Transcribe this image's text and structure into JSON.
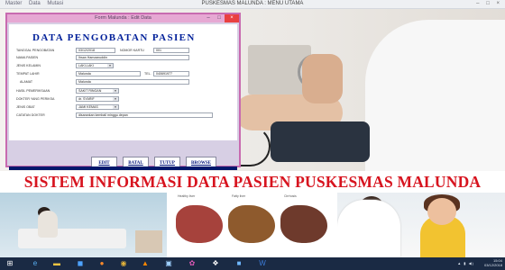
{
  "main_window": {
    "title": "PUSKESMAS MALUNDA : MENU UTAMA",
    "menu_items": [
      "Master",
      "Data",
      "Mutasi"
    ],
    "controls": [
      "–",
      "□",
      "×"
    ]
  },
  "dialog": {
    "title": "Form Malunda : Edit Data",
    "controls": [
      "–",
      "□",
      "×"
    ],
    "heading": "DATA PENGOBATAN PASIEN",
    "fields": {
      "tanggal_label": "TANGGAL PENGOBATAN",
      "tanggal_value": "03/12/2018",
      "nomor_kartu_label": "NOMOR KARTU",
      "nomor_kartu_value": "001",
      "nama_label": "NAMA PASIEN",
      "nama_value": "Ihsan Hamzanuddin",
      "jenis_kelamin_label": "JENIS KELAMIN",
      "jenis_kelamin_value": "LAKI-LAKI",
      "tempat_lahir_label": "TEMPAT LAHIR",
      "tempat_lahir_value": "Malunda",
      "tel_label": "TEL.",
      "tel_value": "040691977",
      "alamat_label": "ALAMAT",
      "alamat_value": "Malunda",
      "hasil_label": "HASIL PEMERIKSAAN",
      "hasil_value": "SAKIT RINGAN",
      "dokter_label": "DOKTER YANG PERIKSA",
      "dokter_value": "dr. SYARIF",
      "obat_label": "JENIS OBAT",
      "obat_value": "JAMI KEMAS",
      "catatan_label": "CATATAN DOKTER",
      "catatan_value": "disarankan kembali minggu depan"
    },
    "buttons": {
      "edit": "EDIT",
      "batal": "BATAL",
      "tutup": "TUTUP",
      "browse": "BROWSE"
    }
  },
  "banner": {
    "text": "SISTEM INFORMASI DATA PASIEN PUSKESMAS MALUNDA"
  },
  "liver_captions": [
    "Healthy liver",
    "Fatty liver",
    "Cirrhosis"
  ],
  "taskbar": {
    "icons": [
      "windows-start-icon",
      "ie-icon",
      "file-explorer-icon",
      "store-icon",
      "firefox-icon",
      "chrome-icon",
      "vlc-icon",
      "photos-icon",
      "paint-icon",
      "app-icon",
      "app-icon-2",
      "word-icon"
    ],
    "time": "15:04",
    "date": "03/12/2018"
  }
}
